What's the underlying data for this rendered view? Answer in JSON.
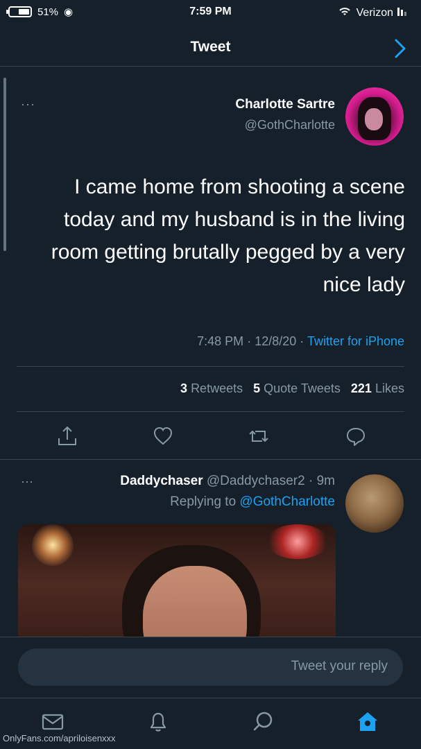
{
  "status_bar": {
    "carrier": "Verizon",
    "time": "7:59 PM",
    "battery": "51%"
  },
  "header": {
    "title": "Tweet"
  },
  "tweet": {
    "author_name": "Charlotte Sartre",
    "author_handle": "@GothCharlotte",
    "text": "I came home from shooting a scene today and my husband is in the living room getting brutally pegged by a very nice lady",
    "time": "7:48 PM",
    "date": "12/8/20",
    "source": "Twitter for iPhone",
    "retweets_count": "3",
    "retweets_label": "Retweets",
    "quote_count": "5",
    "quote_label": "Quote Tweets",
    "likes_count": "221",
    "likes_label": "Likes",
    "more": "···"
  },
  "reply": {
    "author_name": "Daddychaser",
    "author_handle": "@Daddychaser2",
    "age": "9m",
    "replying_to_label": "Replying to",
    "replying_to_handle": "@GothCharlotte",
    "more": "···"
  },
  "compose": {
    "placeholder": "Tweet your reply"
  },
  "watermark": "OnlyFans.com/apriloisenxxx",
  "colors": {
    "background": "#15202b",
    "accent": "#1da1f2",
    "muted": "#8899a6",
    "divider": "#38444d"
  }
}
